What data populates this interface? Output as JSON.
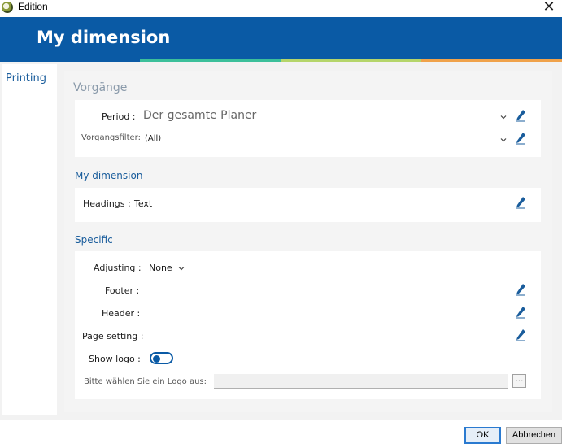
{
  "window": {
    "title": "Edition",
    "close_glyph": "✕",
    "icon": "app-logo-icon"
  },
  "header": {
    "title": "My dimension"
  },
  "nav": {
    "items": [
      {
        "label": "Printing"
      }
    ]
  },
  "sections": {
    "vorgange": {
      "title": "Vorgänge",
      "period_label": "Period :",
      "period_value": "Der gesamte Planer",
      "filter_label": "Vorgangsfilter:",
      "filter_value": "(All)"
    },
    "my_dimension": {
      "title": "My dimension",
      "headings_label": "Headings :",
      "headings_value": "Text"
    },
    "specific": {
      "title": "Specific",
      "adjusting_label": "Adjusting :",
      "adjusting_value": "None",
      "footer_label": "Footer :",
      "header_label": "Header :",
      "page_setting_label": "Page setting :",
      "show_logo_label": "Show logo :",
      "show_logo_on": false,
      "logo_prompt": "Bitte wählen Sie ein Logo aus:",
      "logo_value": "",
      "browse_label": "..."
    }
  },
  "buttons": {
    "ok": "OK",
    "cancel": "Abbrechen"
  },
  "colors": {
    "brand_blue": "#0a5aa5",
    "accent_teal": "#3cbf9a",
    "accent_green": "#b5d56a",
    "accent_orange": "#f0a24a",
    "link_blue": "#1a5d9c"
  }
}
